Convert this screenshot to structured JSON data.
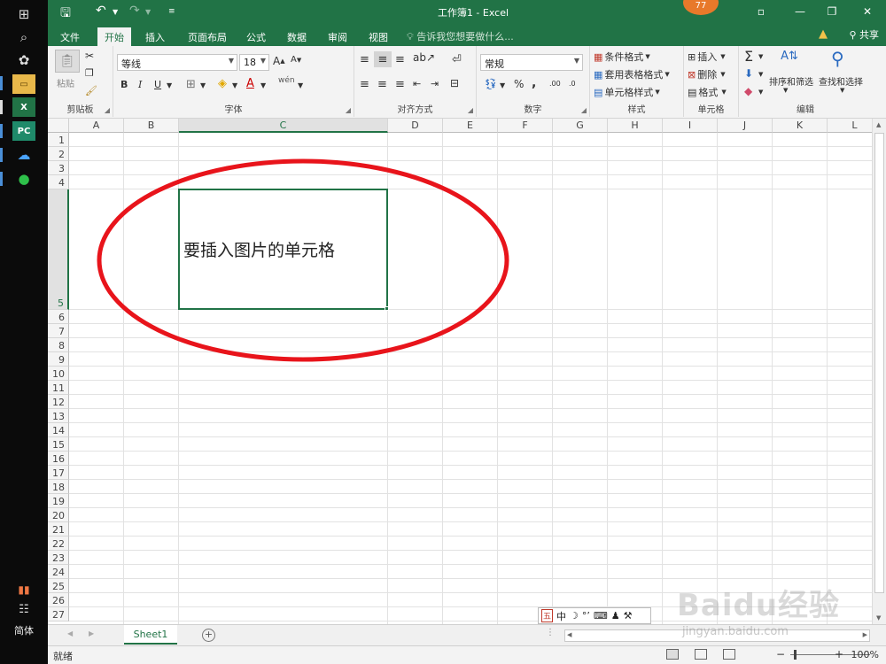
{
  "window": {
    "title": "工作簿1 - Excel",
    "notification_count": "77",
    "minimize": "—",
    "restore": "❐",
    "close": "✕",
    "ribbon_display": "▫"
  },
  "taskbar": {
    "ime_mode": "简体"
  },
  "menu_tabs": [
    "文件",
    "开始",
    "插入",
    "页面布局",
    "公式",
    "数据",
    "审阅",
    "视图"
  ],
  "tell_me": "告诉我您想要做什么...",
  "share": "共享",
  "ribbon": {
    "clipboard": {
      "label": "剪贴板",
      "paste": "粘贴"
    },
    "font": {
      "label": "字体",
      "family": "等线",
      "size": "18",
      "bold": "B",
      "italic": "I",
      "underline": "U",
      "font_color": "A",
      "wen": "wén"
    },
    "alignment": {
      "label": "对齐方式"
    },
    "number": {
      "label": "数字",
      "format": "常规",
      "percent": "%",
      "comma": ",",
      "inc_dec": ".00",
      "dec_dec": ".0"
    },
    "styles": {
      "label": "样式",
      "conditional": "条件格式",
      "table": "套用表格格式",
      "cell_styles": "单元格样式"
    },
    "cells": {
      "label": "单元格",
      "insert": "插入",
      "delete": "删除",
      "format": "格式"
    },
    "editing": {
      "label": "编辑",
      "sort_filter": "排序和筛选",
      "find_select": "查找和选择"
    }
  },
  "grid": {
    "columns": [
      "A",
      "B",
      "C",
      "D",
      "E",
      "F",
      "G",
      "H",
      "I",
      "J",
      "K",
      "L"
    ],
    "selected_column": "C",
    "rows": [
      "1",
      "2",
      "3",
      "4",
      "5",
      "6",
      "7",
      "8",
      "9",
      "10",
      "11",
      "12",
      "13",
      "14",
      "15",
      "16",
      "17",
      "18",
      "19",
      "20",
      "21",
      "22",
      "23",
      "24",
      "25",
      "26",
      "27"
    ],
    "selected_row": "5",
    "active_cell": "C5",
    "cell_value": "要插入图片的单元格"
  },
  "sheets": [
    "Sheet1"
  ],
  "ime_toolbar": [
    "中",
    "☽",
    "°’",
    "⌨",
    "♟",
    "⚒"
  ],
  "status": {
    "ready": "就绪",
    "zoom": "100%"
  },
  "watermark": {
    "brand": "Baidu经验",
    "url": "jingyan.baidu.com"
  },
  "colors": {
    "excel_green": "#217346",
    "annotation_red": "#e8141b"
  }
}
